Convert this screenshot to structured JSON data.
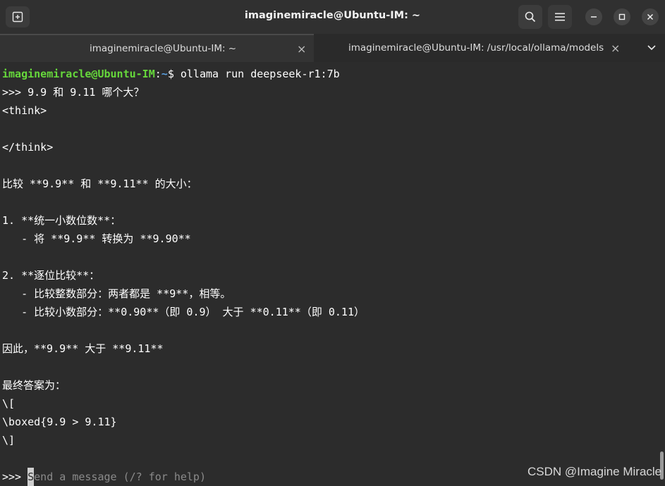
{
  "window": {
    "title": "imaginemiracle@Ubuntu-IM: ~"
  },
  "tabs": [
    {
      "label": "imaginemiracle@Ubuntu-IM: ~",
      "close": "×"
    },
    {
      "label": "imaginemiracle@Ubuntu-IM: /usr/local/ollama/models",
      "close": "×"
    }
  ],
  "terminal": {
    "prompt_user": "imaginemiracle@Ubuntu-IM",
    "prompt_sep": ":",
    "prompt_path": "~",
    "prompt_dollar": "$ ",
    "command": "ollama run deepseek-r1:7b",
    "lines": [
      ">>> 9.9 和 9.11 哪个大？",
      "<think>",
      "",
      "</think>",
      "",
      "比较 **9.9** 和 **9.11** 的大小：",
      "",
      "1. **统一小数位数**：",
      "   - 将 **9.9** 转换为 **9.90**",
      "",
      "2. **逐位比较**：",
      "   - 比较整数部分：两者都是 **9**，相等。",
      "   - 比较小数部分：**0.90**（即 0.9） 大于 **0.11**（即 0.11）",
      "",
      "因此，**9.9** 大于 **9.11**",
      "",
      "最终答案为：",
      "\\[",
      "\\boxed{9.9 > 9.11}",
      "\\]"
    ],
    "input_prompt": ">>> ",
    "cursor_char": "S",
    "input_placeholder": "end a message (/? for help)"
  },
  "watermark": "CSDN @Imagine Miracle"
}
